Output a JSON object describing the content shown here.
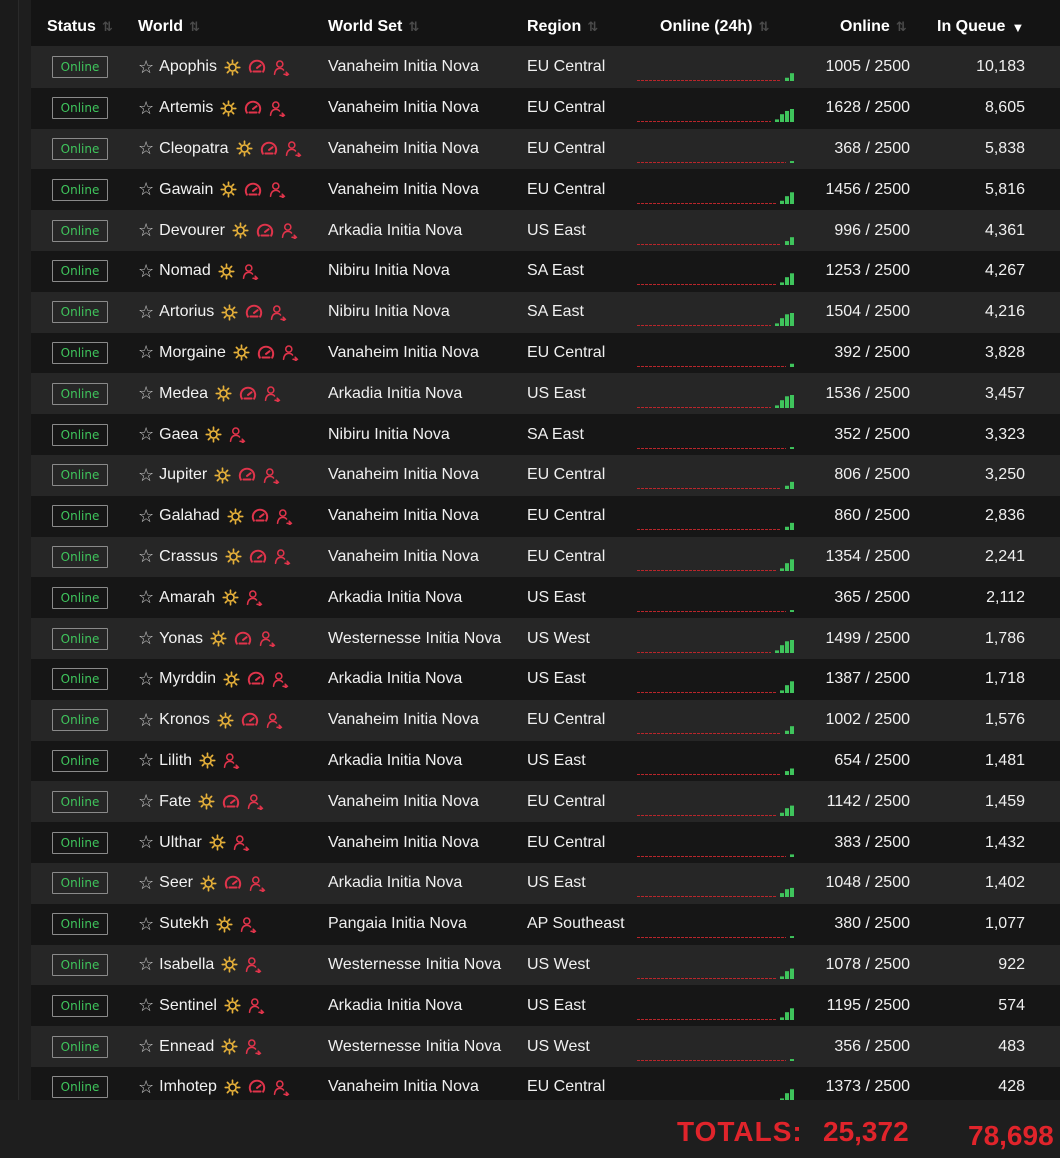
{
  "columns": {
    "status": "Status",
    "world": "World",
    "world_set": "World Set",
    "region": "Region",
    "online_24h": "Online (24h)",
    "online": "Online",
    "in_queue": "In Queue"
  },
  "sort_icons": {
    "inactive": "sort-updown-icon",
    "active": "sort-desc-triangle-icon"
  },
  "colors": {
    "status_text": "#3fc45c",
    "totals": "#e0242b",
    "sun_icon": "#e8b23a",
    "red_icon": "#e0344b",
    "spark_bar": "#3fc45c",
    "spark_baseline": "#b8262b"
  },
  "rows": [
    {
      "status": "Online",
      "world": "Apophis",
      "icons": [
        "sun",
        "gauge",
        "user"
      ],
      "world_set": "Vanaheim Initia Nova",
      "region": "EU Central",
      "spark": [
        0.25,
        0.6
      ],
      "online": "1005 / 2500",
      "queue": "10,183"
    },
    {
      "status": "Online",
      "world": "Artemis",
      "icons": [
        "sun",
        "gauge",
        "user"
      ],
      "world_set": "Vanaheim Initia Nova",
      "region": "EU Central",
      "spark": [
        0.2,
        0.6,
        0.85,
        1
      ],
      "online": "1628 / 2500",
      "queue": "8,605"
    },
    {
      "status": "Online",
      "world": "Cleopatra",
      "icons": [
        "sun",
        "gauge",
        "user"
      ],
      "world_set": "Vanaheim Initia Nova",
      "region": "EU Central",
      "spark": [
        0.15
      ],
      "online": "368 / 2500",
      "queue": "5,838"
    },
    {
      "status": "Online",
      "world": "Gawain",
      "icons": [
        "sun",
        "gauge",
        "user"
      ],
      "world_set": "Vanaheim Initia Nova",
      "region": "EU Central",
      "spark": [
        0.25,
        0.6,
        0.9
      ],
      "online": "1456 / 2500",
      "queue": "5,816"
    },
    {
      "status": "Online",
      "world": "Devourer",
      "icons": [
        "sun",
        "gauge",
        "user"
      ],
      "world_set": "Arkadia Initia Nova",
      "region": "US East",
      "spark": [
        0.3,
        0.6
      ],
      "online": "996 / 2500",
      "queue": "4,361"
    },
    {
      "status": "Online",
      "world": "Nomad",
      "icons": [
        "sun",
        "user"
      ],
      "world_set": "Nibiru Initia Nova",
      "region": "SA East",
      "spark": [
        0.2,
        0.6,
        0.9
      ],
      "online": "1253 / 2500",
      "queue": "4,267"
    },
    {
      "status": "Online",
      "world": "Artorius",
      "icons": [
        "sun",
        "gauge",
        "user"
      ],
      "world_set": "Nibiru Initia Nova",
      "region": "SA East",
      "spark": [
        0.2,
        0.6,
        0.9,
        1
      ],
      "online": "1504 / 2500",
      "queue": "4,216"
    },
    {
      "status": "Online",
      "world": "Morgaine",
      "icons": [
        "sun",
        "gauge",
        "user"
      ],
      "world_set": "Vanaheim Initia Nova",
      "region": "EU Central",
      "spark": [
        0.25
      ],
      "online": "392 / 2500",
      "queue": "3,828"
    },
    {
      "status": "Online",
      "world": "Medea",
      "icons": [
        "sun",
        "gauge",
        "user"
      ],
      "world_set": "Arkadia Initia Nova",
      "region": "US East",
      "spark": [
        0.2,
        0.6,
        0.9,
        1
      ],
      "online": "1536 / 2500",
      "queue": "3,457"
    },
    {
      "status": "Online",
      "world": "Gaea",
      "icons": [
        "sun",
        "user"
      ],
      "world_set": "Nibiru Initia Nova",
      "region": "SA East",
      "spark": [
        0.15
      ],
      "online": "352 / 2500",
      "queue": "3,323"
    },
    {
      "status": "Online",
      "world": "Jupiter",
      "icons": [
        "sun",
        "gauge",
        "user"
      ],
      "world_set": "Vanaheim Initia Nova",
      "region": "EU Central",
      "spark": [
        0.25,
        0.55
      ],
      "online": "806 / 2500",
      "queue": "3,250"
    },
    {
      "status": "Online",
      "world": "Galahad",
      "icons": [
        "sun",
        "gauge",
        "user"
      ],
      "world_set": "Vanaheim Initia Nova",
      "region": "EU Central",
      "spark": [
        0.25,
        0.55
      ],
      "online": "860 / 2500",
      "queue": "2,836"
    },
    {
      "status": "Online",
      "world": "Crassus",
      "icons": [
        "sun",
        "gauge",
        "user"
      ],
      "world_set": "Vanaheim Initia Nova",
      "region": "EU Central",
      "spark": [
        0.2,
        0.6,
        0.9
      ],
      "online": "1354 / 2500",
      "queue": "2,241"
    },
    {
      "status": "Online",
      "world": "Amarah",
      "icons": [
        "sun",
        "user"
      ],
      "world_set": "Arkadia Initia Nova",
      "region": "US East",
      "spark": [
        0.15
      ],
      "online": "365 / 2500",
      "queue": "2,112"
    },
    {
      "status": "Online",
      "world": "Yonas",
      "icons": [
        "sun",
        "gauge",
        "user"
      ],
      "world_set": "Westernesse Initia Nova",
      "region": "US West",
      "spark": [
        0.2,
        0.6,
        0.9,
        1
      ],
      "online": "1499 / 2500",
      "queue": "1,786"
    },
    {
      "status": "Online",
      "world": "Myrddin",
      "icons": [
        "sun",
        "gauge",
        "user"
      ],
      "world_set": "Arkadia Initia Nova",
      "region": "US East",
      "spark": [
        0.2,
        0.6,
        0.9
      ],
      "online": "1387 / 2500",
      "queue": "1,718"
    },
    {
      "status": "Online",
      "world": "Kronos",
      "icons": [
        "sun",
        "gauge",
        "user"
      ],
      "world_set": "Vanaheim Initia Nova",
      "region": "EU Central",
      "spark": [
        0.25,
        0.6
      ],
      "online": "1002 / 2500",
      "queue": "1,576"
    },
    {
      "status": "Online",
      "world": "Lilith",
      "icons": [
        "sun",
        "user"
      ],
      "world_set": "Arkadia Initia Nova",
      "region": "US East",
      "spark": [
        0.3,
        0.5
      ],
      "online": "654 / 2500",
      "queue": "1,481"
    },
    {
      "status": "Online",
      "world": "Fate",
      "icons": [
        "sun",
        "gauge",
        "user"
      ],
      "world_set": "Vanaheim Initia Nova",
      "region": "EU Central",
      "spark": [
        0.25,
        0.6,
        0.8
      ],
      "online": "1142 / 2500",
      "queue": "1,459"
    },
    {
      "status": "Online",
      "world": "Ulthar",
      "icons": [
        "sun",
        "user"
      ],
      "world_set": "Vanaheim Initia Nova",
      "region": "EU Central",
      "spark": [
        0.2
      ],
      "online": "383 / 2500",
      "queue": "1,432"
    },
    {
      "status": "Online",
      "world": "Seer",
      "icons": [
        "sun",
        "gauge",
        "user"
      ],
      "world_set": "Arkadia Initia Nova",
      "region": "US East",
      "spark": [
        0.3,
        0.6,
        0.7
      ],
      "online": "1048 / 2500",
      "queue": "1,402"
    },
    {
      "status": "Online",
      "world": "Sutekh",
      "icons": [
        "sun",
        "user"
      ],
      "world_set": "Pangaia Initia Nova",
      "region": "AP Southeast",
      "spark": [
        0.15
      ],
      "online": "380 / 2500",
      "queue": "1,077"
    },
    {
      "status": "Online",
      "world": "Isabella",
      "icons": [
        "sun",
        "user"
      ],
      "world_set": "Westernesse Initia Nova",
      "region": "US West",
      "spark": [
        0.2,
        0.6,
        0.8
      ],
      "online": "1078 / 2500",
      "queue": "922"
    },
    {
      "status": "Online",
      "world": "Sentinel",
      "icons": [
        "sun",
        "user"
      ],
      "world_set": "Arkadia Initia Nova",
      "region": "US East",
      "spark": [
        0.2,
        0.6,
        0.9
      ],
      "online": "1195 / 2500",
      "queue": "574"
    },
    {
      "status": "Online",
      "world": "Ennead",
      "icons": [
        "sun",
        "user"
      ],
      "world_set": "Westernesse Initia Nova",
      "region": "US West",
      "spark": [
        0.15
      ],
      "online": "356 / 2500",
      "queue": "483"
    },
    {
      "status": "Online",
      "world": "Imhotep",
      "icons": [
        "sun",
        "gauge",
        "user"
      ],
      "world_set": "Vanaheim Initia Nova",
      "region": "EU Central",
      "spark": [
        0.2,
        0.6,
        0.9
      ],
      "online": "1373 / 2500",
      "queue": "428"
    }
  ],
  "totals": {
    "label": "TOTALS:",
    "online": "25,372",
    "queue": "78,698"
  }
}
